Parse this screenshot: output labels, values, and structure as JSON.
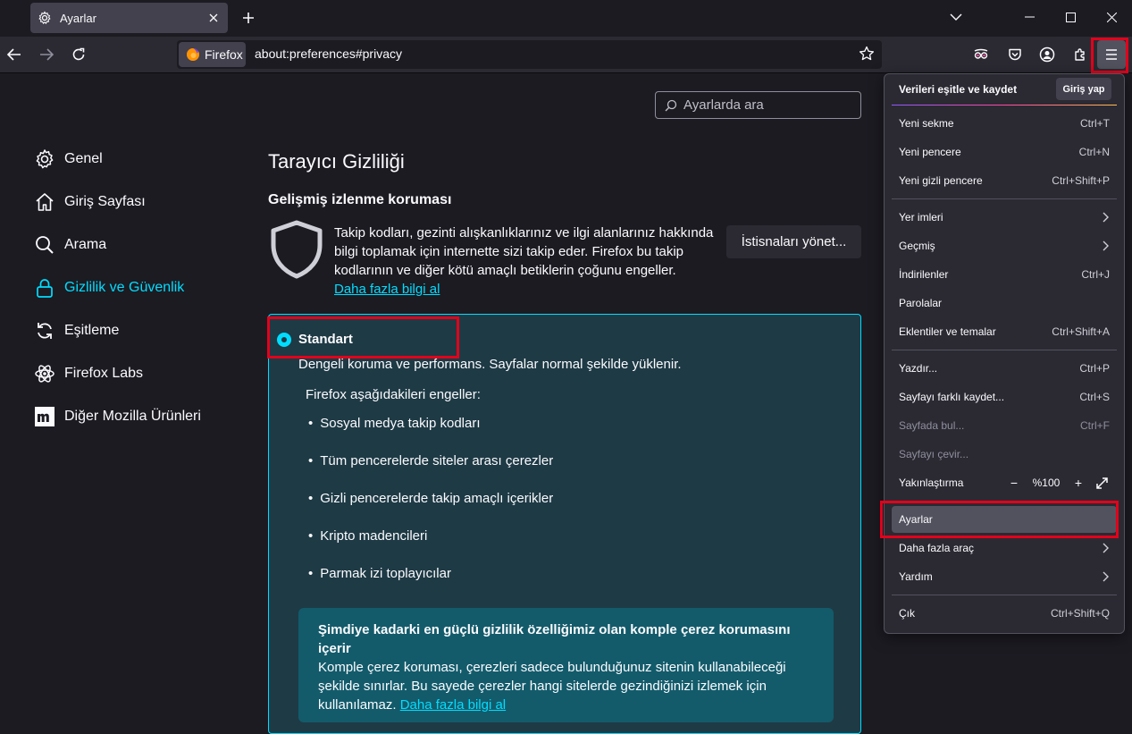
{
  "tab": {
    "title": "Ayarlar"
  },
  "url": {
    "identity": "Firefox",
    "address": "about:preferences#privacy"
  },
  "search": {
    "placeholder": "Ayarlarda ara"
  },
  "categories": [
    {
      "label": "Genel",
      "icon": "gear-icon"
    },
    {
      "label": "Giriş Sayfası",
      "icon": "home-icon"
    },
    {
      "label": "Arama",
      "icon": "search-icon"
    },
    {
      "label": "Gizlilik ve Güvenlik",
      "icon": "lock-icon",
      "selected": true
    },
    {
      "label": "Eşitleme",
      "icon": "sync-icon"
    },
    {
      "label": "Firefox Labs",
      "icon": "labs-icon"
    },
    {
      "label": "Diğer Mozilla Ürünleri",
      "icon": "mozilla-icon"
    }
  ],
  "main": {
    "title": "Tarayıcı Gizliliği",
    "section": "Gelişmiş izlenme koruması",
    "description": "Takip kodları, gezinti alışkanlıklarınız ve ilgi alanlarınız hakkında bilgi toplamak için internette sizi takip eder. Firefox bu takip kodlarının ve diğer kötü amaçlı betiklerin çoğunu engeller.",
    "learn_more": "Daha fazla bilgi al",
    "exceptions_button": "İstisnaları yönet...",
    "standard": {
      "label": "Standart",
      "description": "Dengeli koruma ve performans. Sayfalar normal şekilde yüklenir.",
      "blocks_header": "Firefox aşağıdakileri engeller:",
      "blocks": [
        "Sosyal medya takip kodları",
        "Tüm pencerelerde siteler arası çerezler",
        "Gizli pencerelerde takip amaçlı içerikler",
        "Kripto madencileri",
        "Parmak izi toplayıcılar"
      ],
      "info_title": "Şimdiye kadarki en güçlü gizlilik özelliğimiz olan komple çerez korumasını içerir",
      "info_body": "Komple çerez koruması, çerezleri sadece bulunduğunuz sitenin kullanabileceği şekilde sınırlar. Bu sayede çerezler hangi sitelerde gezindiğinizi izlemek için kullanılamaz.",
      "info_link": "Daha fazla bilgi al"
    }
  },
  "menu": {
    "sync_title": "Verileri eşitle ve kaydet",
    "signin": "Giriş yap",
    "items": [
      {
        "label": "Yeni sekme",
        "shortcut": "Ctrl+T"
      },
      {
        "label": "Yeni pencere",
        "shortcut": "Ctrl+N"
      },
      {
        "label": "Yeni gizli pencere",
        "shortcut": "Ctrl+Shift+P"
      },
      {
        "label": "Yer imleri",
        "shortcut": ""
      },
      {
        "label": "Geçmiş",
        "shortcut": ""
      },
      {
        "label": "İndirilenler",
        "shortcut": "Ctrl+J"
      },
      {
        "label": "Parolalar",
        "shortcut": ""
      },
      {
        "label": "Eklentiler ve temalar",
        "shortcut": "Ctrl+Shift+A"
      },
      {
        "label": "Yazdır...",
        "shortcut": "Ctrl+P"
      },
      {
        "label": "Sayfayı farklı kaydet...",
        "shortcut": "Ctrl+S"
      },
      {
        "label": "Sayfada bul...",
        "shortcut": "Ctrl+F"
      },
      {
        "label": "Sayfayı çevir...",
        "shortcut": ""
      },
      {
        "label": "Yakınlaştırma",
        "shortcut": ""
      },
      {
        "label": "Ayarlar",
        "shortcut": ""
      },
      {
        "label": "Daha fazla araç",
        "shortcut": ""
      },
      {
        "label": "Yardım",
        "shortcut": ""
      },
      {
        "label": "Çık",
        "shortcut": "Ctrl+Shift+Q"
      }
    ],
    "zoom": {
      "minus": "−",
      "value": "%100",
      "plus": "+"
    }
  }
}
